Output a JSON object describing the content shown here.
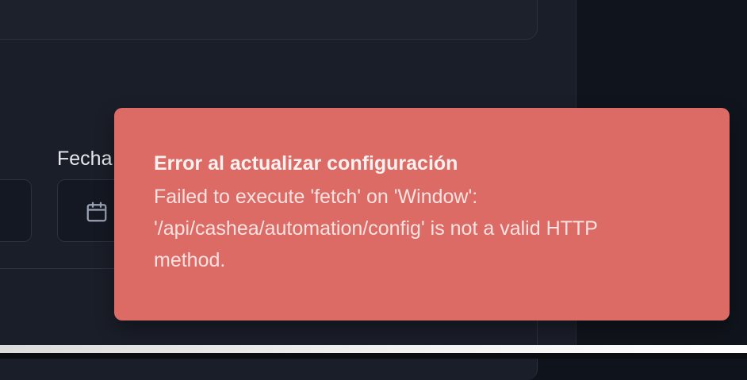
{
  "form": {
    "date_label": "Fecha",
    "date_icon": "calendar-icon"
  },
  "toast": {
    "title": "Error al actualizar configuración",
    "message": "Failed to execute 'fetch' on 'Window': '/api/cashea/automation/config' is not a valid HTTP method.",
    "background_color": "#dc6a65"
  }
}
